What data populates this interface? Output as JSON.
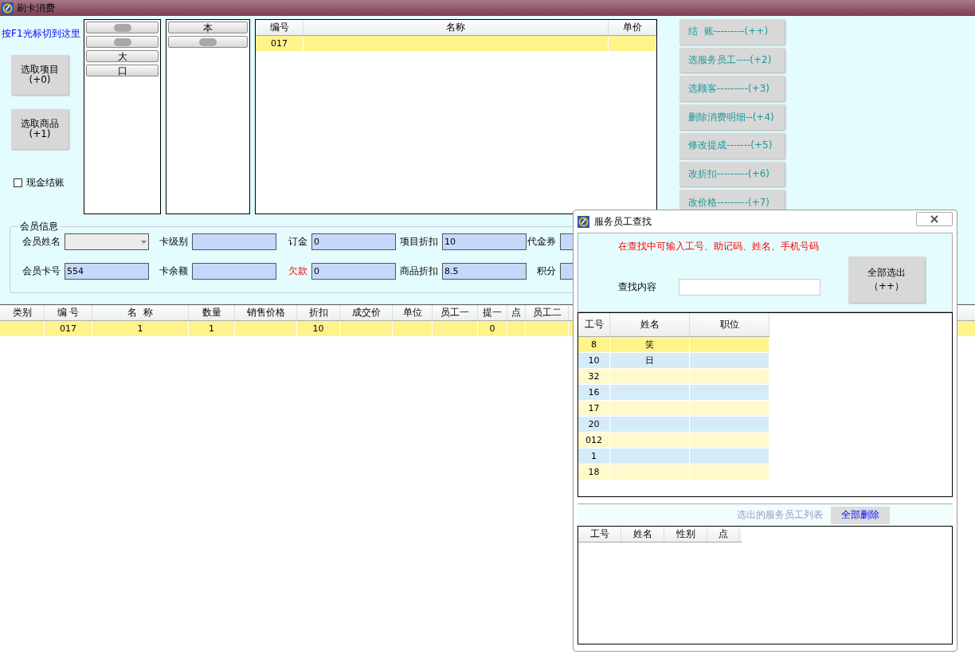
{
  "window": {
    "title": "刷卡消费"
  },
  "hint_link": "按F1光标切到这里",
  "pick_buttons": [
    {
      "label": "选取项目",
      "key": "(+0)"
    },
    {
      "label": "选取商品",
      "key": "(+1)"
    }
  ],
  "cash_checkout": {
    "label": "现金结账",
    "checked": false
  },
  "category_list": [
    {
      "redacted": true
    },
    {
      "redacted": true
    },
    {
      "label": "大",
      "redacted": false
    },
    {
      "label": "口",
      "redacted": false
    }
  ],
  "subcategory_list": [
    {
      "label": "本",
      "redacted": false
    },
    {
      "redacted": true
    }
  ],
  "item_table": {
    "columns": [
      "编号",
      "名称",
      "单价"
    ],
    "rows": [
      {
        "cells": [
          "017",
          "",
          ""
        ],
        "selected": true
      }
    ]
  },
  "actions": [
    {
      "label": "结  账---------(++)"
    },
    {
      "label": "选服务员工----(+2)"
    },
    {
      "label": "选顾客---------(+3)"
    },
    {
      "label": "删除消费明细--(+4)"
    },
    {
      "label": "修改提成-------(+5)"
    },
    {
      "label": "改折扣---------(+6)"
    },
    {
      "label": "改价格---------(+7)"
    }
  ],
  "member": {
    "title": "会员信息",
    "fields": [
      {
        "label": "会员姓名",
        "kind": "select",
        "alert": false
      },
      {
        "label": "卡级别",
        "kind": "text",
        "alert": false
      },
      {
        "label": "订金",
        "value": "0",
        "kind": "text",
        "alert": false
      },
      {
        "label": "项目折扣",
        "value": "10",
        "kind": "text",
        "alert": false
      },
      {
        "label": "代金券",
        "kind": "text",
        "alert": false
      },
      {
        "label": "会员卡号",
        "value": "554",
        "kind": "text",
        "alert": false
      },
      {
        "label": "卡余额",
        "kind": "text",
        "alert": false
      },
      {
        "label": "欠款",
        "value": "0",
        "kind": "text",
        "alert": true
      },
      {
        "label": "商品折扣",
        "value": "8.5",
        "kind": "text",
        "alert": false
      },
      {
        "label": "积分",
        "kind": "text",
        "alert": false
      }
    ]
  },
  "detail_table": {
    "columns": [
      "类别",
      "编 号",
      "名  称",
      "数量",
      "销售价格",
      "折扣",
      "成交价",
      "单位",
      "员工一",
      "提一",
      "点",
      "员工二"
    ],
    "rows": [
      {
        "cells": [
          "",
          "017",
          "1",
          "1",
          "",
          "10",
          "",
          "",
          "",
          "0",
          "",
          ""
        ],
        "selected": true
      }
    ]
  },
  "dialog": {
    "title": "服务员工查找",
    "tip": "在查找中可输入工号、助记码、姓名、手机号码",
    "search_label": "查找内容",
    "select_all": "全部选出（++）",
    "staff_columns": [
      "工号",
      "姓名",
      "职位"
    ],
    "staff_rows": [
      {
        "cells": [
          "8",
          "笑",
          ""
        ],
        "selected": true
      },
      {
        "cells": [
          "10",
          "日",
          ""
        ],
        "selected": false
      },
      {
        "cells": [
          "32",
          "",
          ""
        ],
        "selected": false
      },
      {
        "cells": [
          "16",
          "",
          ""
        ],
        "selected": false
      },
      {
        "cells": [
          "17",
          "",
          ""
        ],
        "selected": false
      },
      {
        "cells": [
          "20",
          "",
          ""
        ],
        "selected": false
      },
      {
        "cells": [
          "012",
          "",
          ""
        ],
        "selected": false
      },
      {
        "cells": [
          "1",
          "",
          ""
        ],
        "selected": false
      },
      {
        "cells": [
          "18",
          "",
          ""
        ],
        "selected": false
      }
    ],
    "chosen_label": "选出的服务员工列表",
    "delete_all": "全部删除",
    "chosen_columns": [
      "工号",
      "姓名",
      "性别",
      "点"
    ]
  }
}
